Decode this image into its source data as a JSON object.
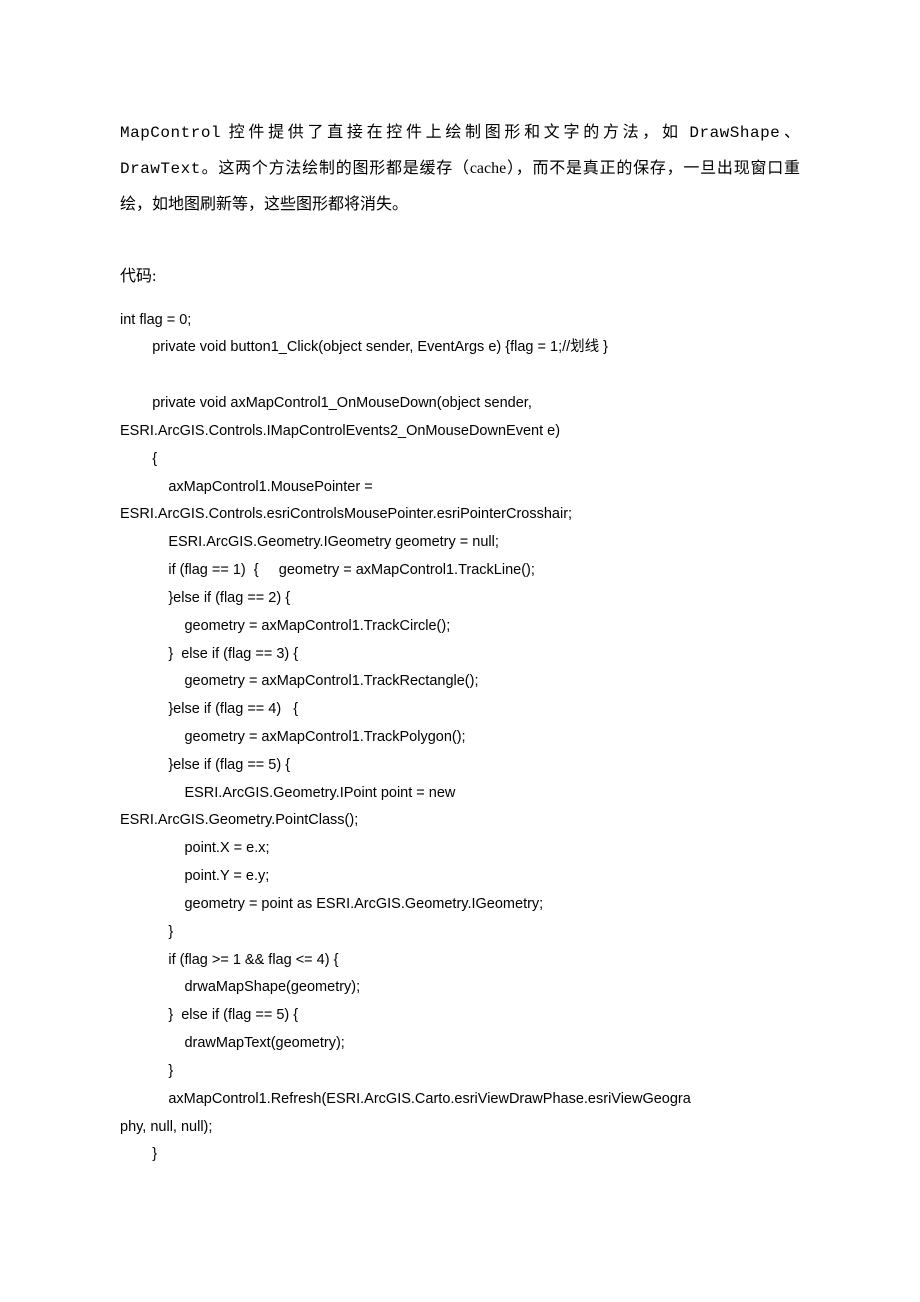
{
  "intro": {
    "part1": "MapControl",
    "part2": " 控件提供了直接在控件上绘制图形和文字的方法，如 ",
    "part3": "DrawShape",
    "part4": "、",
    "part5": "DrawText",
    "part6": "。这两个方法绘制的图形都是缓存（cache），而不是真正的保存，一旦出现窗口重绘，如地图刷新等，这些图形都将消失。"
  },
  "code_label": "代码:",
  "code_lines": [
    "int flag = 0;",
    "        private void button1_Click(object sender, EventArgs e) {flag = 1;//划线 }",
    "",
    "        private void axMapControl1_OnMouseDown(object sender,",
    "ESRI.ArcGIS.Controls.IMapControlEvents2_OnMouseDownEvent e)",
    "        {",
    "            axMapControl1.MousePointer =",
    "ESRI.ArcGIS.Controls.esriControlsMousePointer.esriPointerCrosshair;",
    "            ESRI.ArcGIS.Geometry.IGeometry geometry = null;",
    "            if (flag == 1)  {     geometry = axMapControl1.TrackLine();",
    "            }else if (flag == 2) {",
    "                geometry = axMapControl1.TrackCircle();",
    "            }  else if (flag == 3) {",
    "                geometry = axMapControl1.TrackRectangle();",
    "            }else if (flag == 4)   {",
    "                geometry = axMapControl1.TrackPolygon();",
    "            }else if (flag == 5) {",
    "                ESRI.ArcGIS.Geometry.IPoint point = new",
    "ESRI.ArcGIS.Geometry.PointClass();",
    "                point.X = e.x;",
    "                point.Y = e.y;",
    "                geometry = point as ESRI.ArcGIS.Geometry.IGeometry;",
    "            }",
    "            if (flag >= 1 && flag <= 4) {",
    "                drwaMapShape(geometry);",
    "            }  else if (flag == 5) {",
    "                drawMapText(geometry);",
    "            }",
    "            axMapControl1.Refresh(ESRI.ArcGIS.Carto.esriViewDrawPhase.esriViewGeogra",
    "phy, null, null);",
    "        }"
  ]
}
